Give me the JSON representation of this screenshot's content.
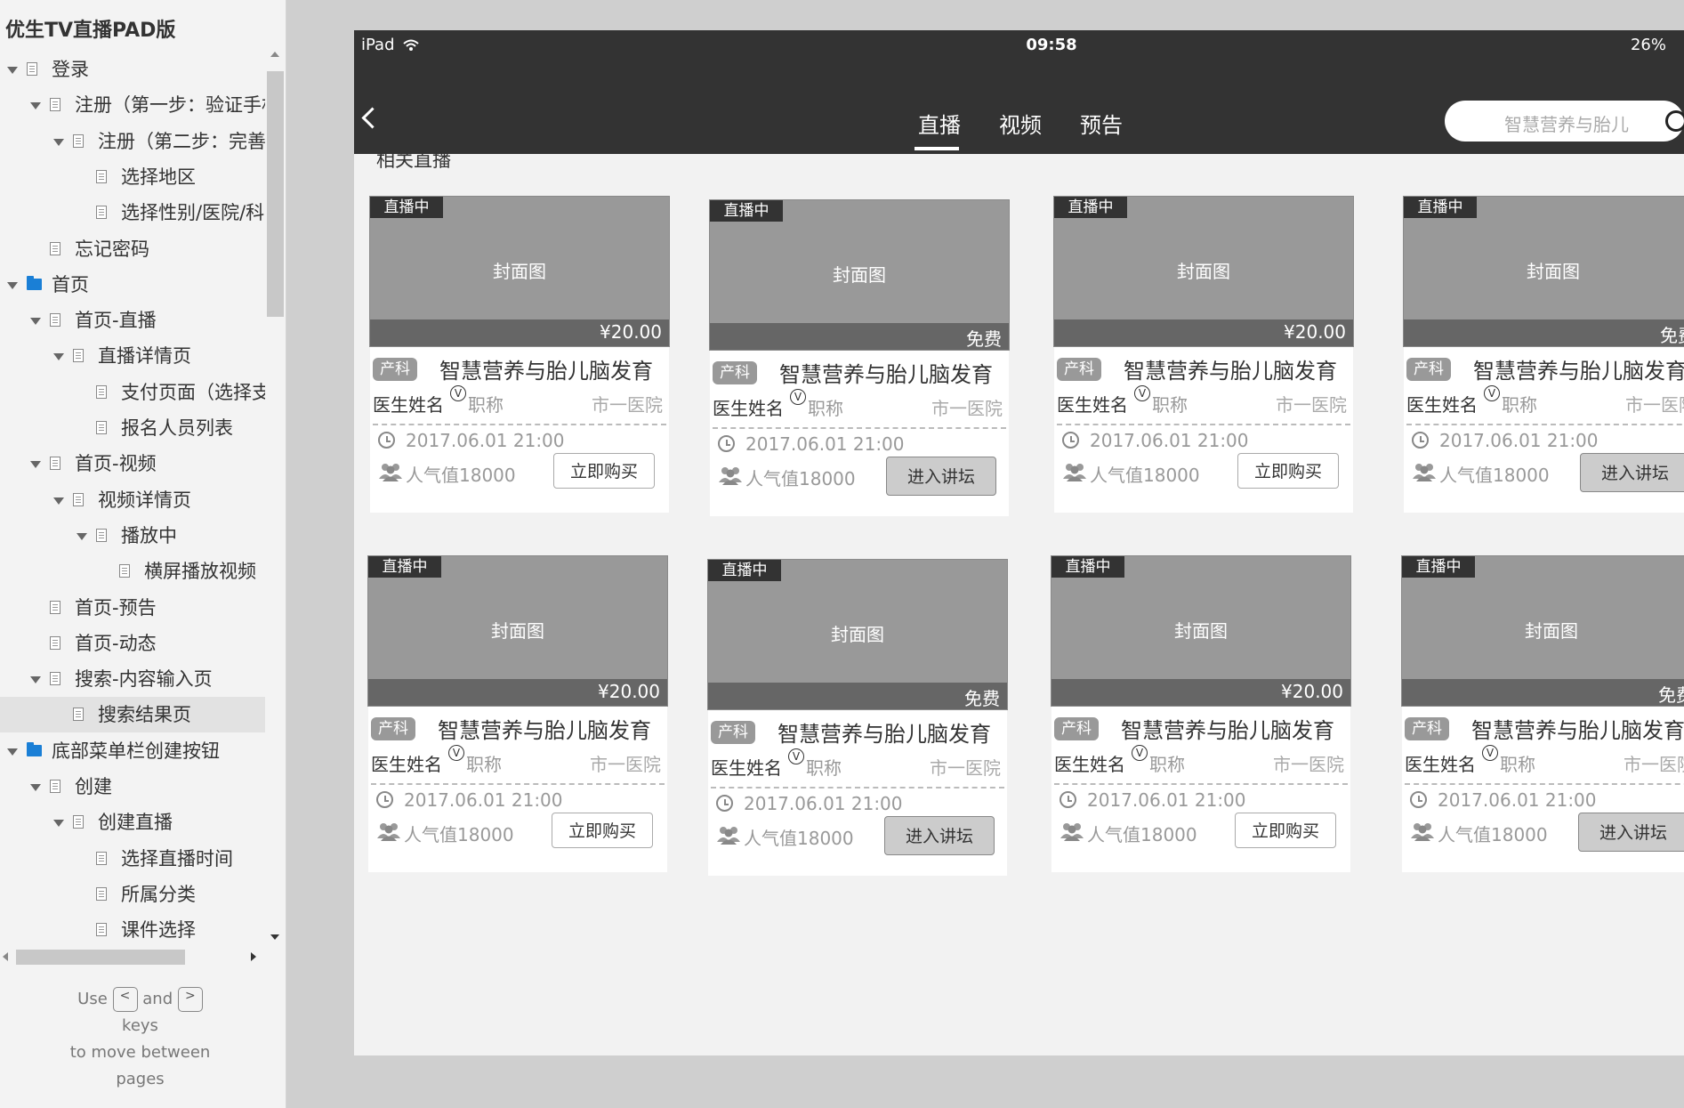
{
  "sidebar": {
    "title": "优生TV直播PAD版",
    "tree": [
      {
        "label": "登录",
        "level": 0,
        "type": "page",
        "expanded": true
      },
      {
        "label": "注册（第一步：验证手机",
        "level": 1,
        "type": "page",
        "expanded": true
      },
      {
        "label": "注册（第二步：完善资料",
        "level": 2,
        "type": "page",
        "expanded": true
      },
      {
        "label": "选择地区",
        "level": 3,
        "type": "page"
      },
      {
        "label": "选择性别/医院/科室",
        "level": 3,
        "type": "page"
      },
      {
        "label": "忘记密码",
        "level": 1,
        "type": "page"
      },
      {
        "label": "首页",
        "level": 0,
        "type": "folder",
        "expanded": true
      },
      {
        "label": "首页-直播",
        "level": 1,
        "type": "page",
        "expanded": true
      },
      {
        "label": "直播详情页",
        "level": 2,
        "type": "page",
        "expanded": true
      },
      {
        "label": "支付页面（选择支付",
        "level": 3,
        "type": "page"
      },
      {
        "label": "报名人员列表",
        "level": 3,
        "type": "page"
      },
      {
        "label": "首页-视频",
        "level": 1,
        "type": "page",
        "expanded": true
      },
      {
        "label": "视频详情页",
        "level": 2,
        "type": "page",
        "expanded": true
      },
      {
        "label": "播放中",
        "level": 3,
        "type": "page",
        "expanded": true
      },
      {
        "label": "横屏播放视频",
        "level": 4,
        "type": "page"
      },
      {
        "label": "首页-预告",
        "level": 1,
        "type": "page"
      },
      {
        "label": "首页-动态",
        "level": 1,
        "type": "page"
      },
      {
        "label": "搜索-内容输入页",
        "level": 1,
        "type": "page",
        "expanded": true
      },
      {
        "label": "搜索结果页",
        "level": 2,
        "type": "page",
        "selected": true
      },
      {
        "label": "底部菜单栏创建按钮",
        "level": 0,
        "type": "folder",
        "expanded": true
      },
      {
        "label": "创建",
        "level": 1,
        "type": "page",
        "expanded": true
      },
      {
        "label": "创建直播",
        "level": 2,
        "type": "page",
        "expanded": true
      },
      {
        "label": "选择直播时间",
        "level": 3,
        "type": "page"
      },
      {
        "label": "所属分类",
        "level": 3,
        "type": "page"
      },
      {
        "label": "课件选择",
        "level": 3,
        "type": "page"
      }
    ],
    "help": {
      "use": "Use",
      "key_prev": "<",
      "and": "and",
      "key_next": ">",
      "rest1": "keys",
      "rest2": "to move between",
      "rest3": "pages"
    }
  },
  "statusbar": {
    "carrier": "iPad",
    "time": "09:58",
    "battery": "26%"
  },
  "navbar": {
    "tabs": [
      {
        "label": "直播",
        "active": true
      },
      {
        "label": "视频"
      },
      {
        "label": "预告"
      }
    ],
    "search_placeholder": "智慧营养与胎儿"
  },
  "section_title": "相关直播",
  "cards": [
    {
      "badge": "直播中",
      "cover": "封面图",
      "price": "¥20.00",
      "tag": "产科",
      "title": "智慧营养与胎儿脑发育",
      "doctor": "医生姓名",
      "v": "V",
      "job": "职称",
      "hospital": "市一医院",
      "time": "2017.06.01 21:00",
      "popularity": "人气值18000",
      "button": "立即购买",
      "button_type": "buy"
    },
    {
      "badge": "直播中",
      "cover": "封面图",
      "price": "免费",
      "tag": "产科",
      "title": "智慧营养与胎儿脑发育",
      "doctor": "医生姓名",
      "v": "V",
      "job": "职称",
      "hospital": "市一医院",
      "time": "2017.06.01 21:00",
      "popularity": "人气值18000",
      "button": "进入讲坛",
      "button_type": "enter"
    },
    {
      "badge": "直播中",
      "cover": "封面图",
      "price": "¥20.00",
      "tag": "产科",
      "title": "智慧营养与胎儿脑发育",
      "doctor": "医生姓名",
      "v": "V",
      "job": "职称",
      "hospital": "市一医院",
      "time": "2017.06.01 21:00",
      "popularity": "人气值18000",
      "button": "立即购买",
      "button_type": "buy"
    },
    {
      "badge": "直播中",
      "cover": "封面图",
      "price": "免费",
      "tag": "产科",
      "title": "智慧营养与胎儿脑发育",
      "doctor": "医生姓名",
      "v": "V",
      "job": "职称",
      "hospital": "市一医院",
      "time": "2017.06.01 21:00",
      "popularity": "人气值18000",
      "button": "进入讲坛",
      "button_type": "enter"
    },
    {
      "badge": "直播中",
      "cover": "封面图",
      "price": "¥20.00",
      "tag": "产科",
      "title": "智慧营养与胎儿脑发育",
      "doctor": "医生姓名",
      "v": "V",
      "job": "职称",
      "hospital": "市一医院",
      "time": "2017.06.01 21:00",
      "popularity": "人气值18000",
      "button": "立即购买",
      "button_type": "buy"
    },
    {
      "badge": "直播中",
      "cover": "封面图",
      "price": "免费",
      "tag": "产科",
      "title": "智慧营养与胎儿脑发育",
      "doctor": "医生姓名",
      "v": "V",
      "job": "职称",
      "hospital": "市一医院",
      "time": "2017.06.01 21:00",
      "popularity": "人气值18000",
      "button": "进入讲坛",
      "button_type": "enter"
    },
    {
      "badge": "直播中",
      "cover": "封面图",
      "price": "¥20.00",
      "tag": "产科",
      "title": "智慧营养与胎儿脑发育",
      "doctor": "医生姓名",
      "v": "V",
      "job": "职称",
      "hospital": "市一医院",
      "time": "2017.06.01 21:00",
      "popularity": "人气值18000",
      "button": "立即购买",
      "button_type": "buy"
    },
    {
      "badge": "直播中",
      "cover": "封面图",
      "price": "免费",
      "tag": "产科",
      "title": "智慧营养与胎儿脑发育",
      "doctor": "医生姓名",
      "v": "V",
      "job": "职称",
      "hospital": "市一医院",
      "time": "2017.06.01 21:00",
      "popularity": "人气值18000",
      "button": "进入讲坛",
      "button_type": "enter"
    }
  ]
}
